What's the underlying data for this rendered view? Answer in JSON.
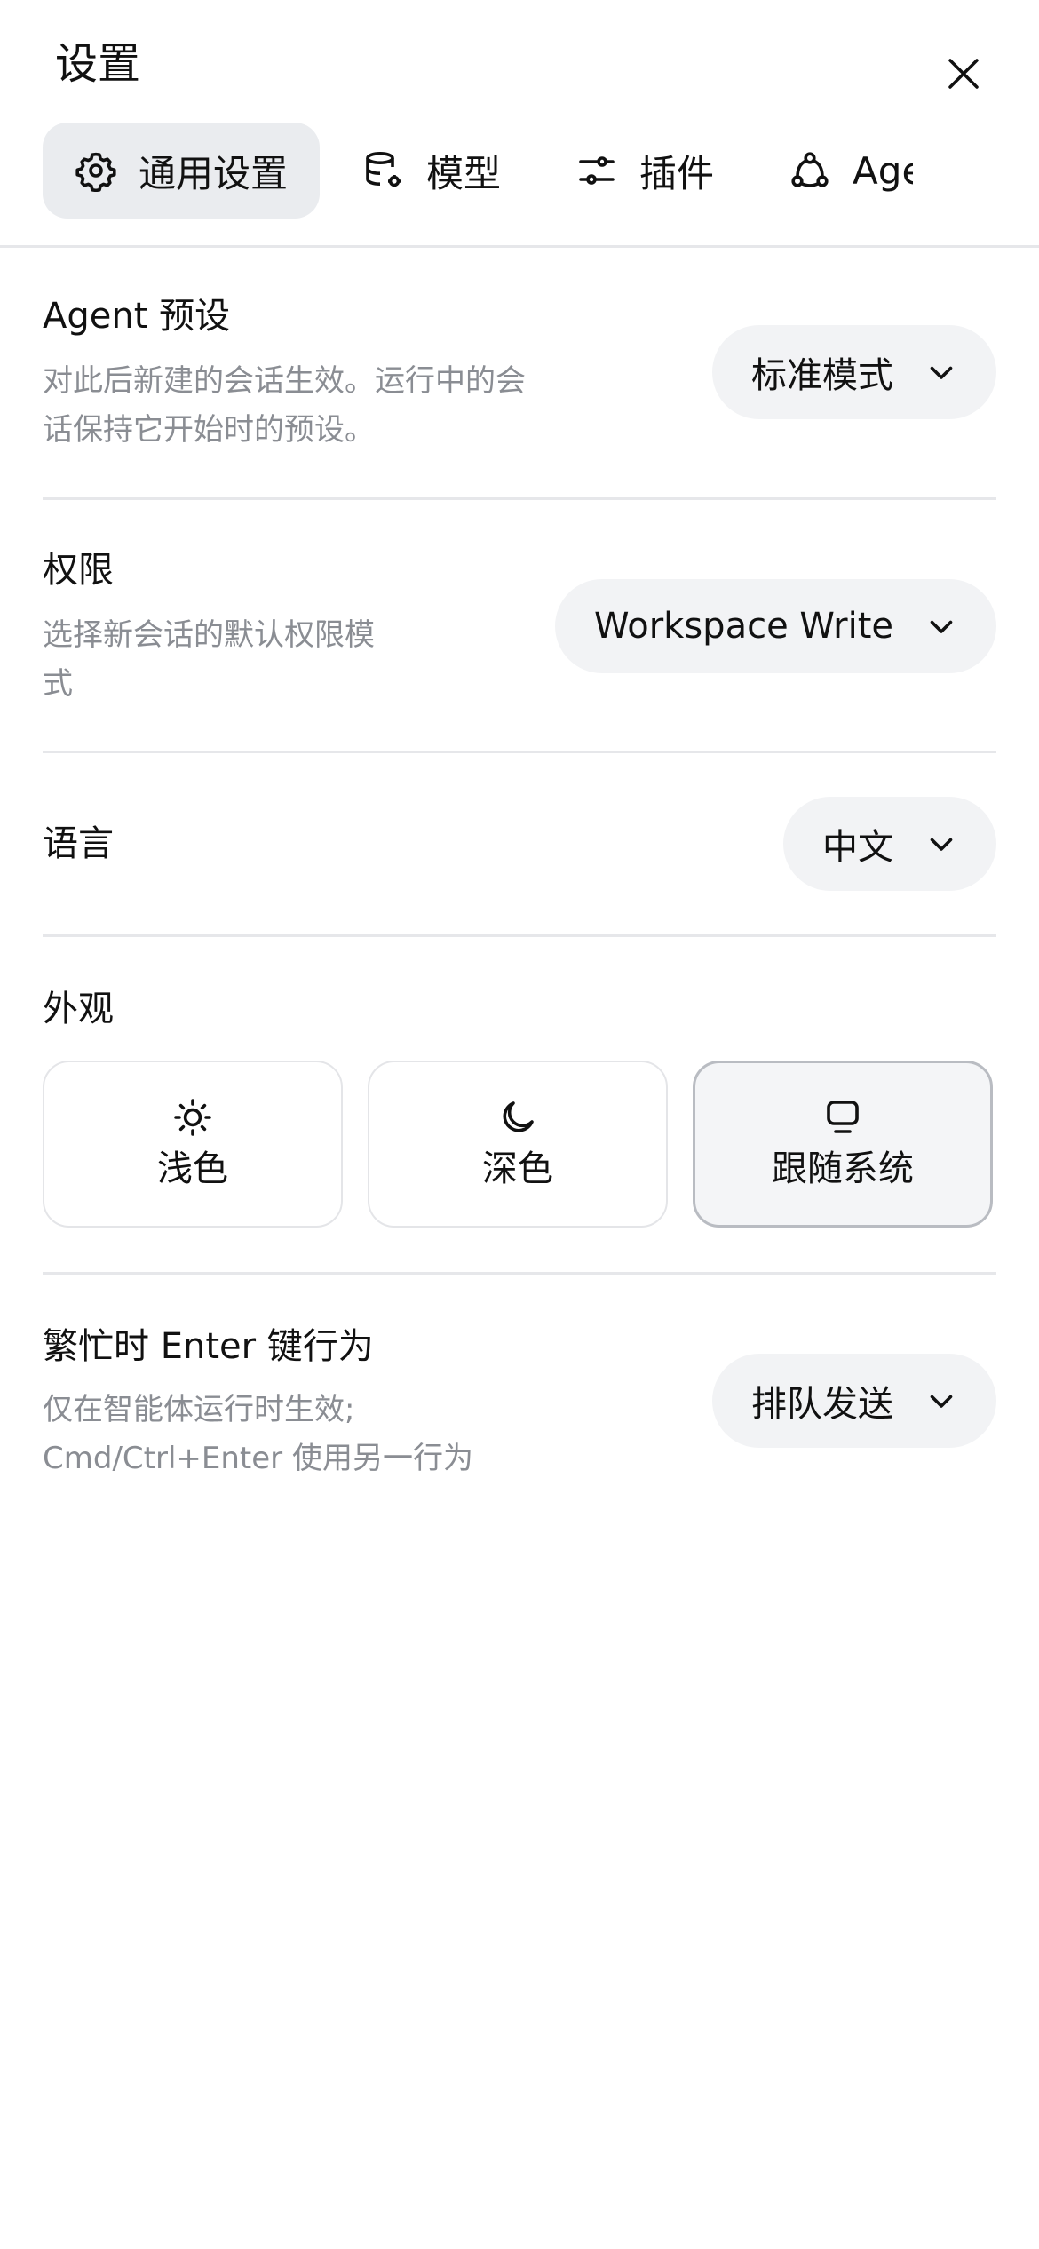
{
  "header": {
    "title": "设置"
  },
  "tabs": [
    {
      "label": "通用设置",
      "icon": "gear-icon",
      "active": true
    },
    {
      "label": "模型",
      "icon": "database-gear-icon",
      "active": false
    },
    {
      "label": "插件",
      "icon": "sliders-icon",
      "active": false
    },
    {
      "label": "Age",
      "icon": "nodes-icon",
      "active": false
    }
  ],
  "agent_preset": {
    "title": "Agent 预设",
    "desc_line1": "对此后新建的会话生效。运行中的会",
    "desc_line2": "话保持它开始时的预设。",
    "value": "标准模式"
  },
  "permissions": {
    "title": "权限",
    "desc_line1": "选择新会话的默认权限模",
    "desc_line2": "式",
    "value": "Workspace Write"
  },
  "language": {
    "title": "语言",
    "value": "中文"
  },
  "appearance": {
    "title": "外观",
    "options": [
      {
        "label": "浅色",
        "icon": "sun-icon",
        "selected": false
      },
      {
        "label": "深色",
        "icon": "moon-icon",
        "selected": false
      },
      {
        "label": "跟随系统",
        "icon": "monitor-icon",
        "selected": true
      }
    ]
  },
  "busy_enter": {
    "title": "繁忙时 Enter 键行为",
    "desc_line1": "仅在智能体运行时生效;",
    "desc_line2": "Cmd/Ctrl+Enter 使用另一行为",
    "value": "排队发送"
  },
  "colors": {
    "accent_bg": "#eaecef",
    "pill_bg": "#f2f3f5",
    "muted_text": "#8a8d93",
    "divider": "#e6e7ea"
  }
}
